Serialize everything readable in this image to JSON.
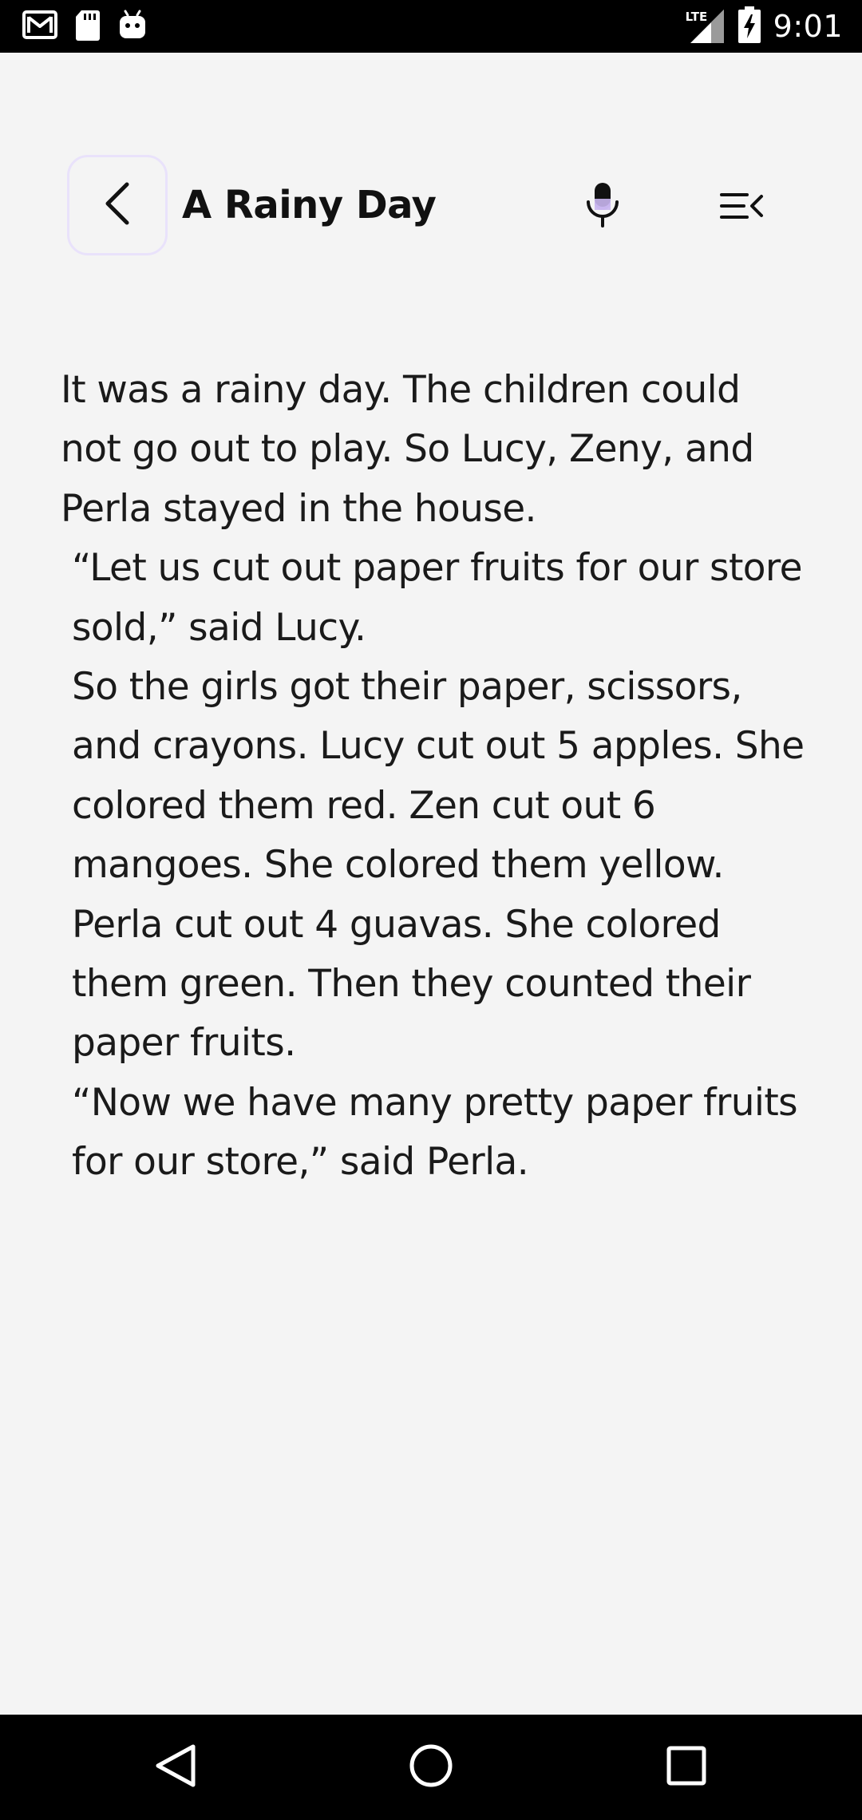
{
  "status_bar": {
    "time": "9:01",
    "network": "LTE",
    "left_icons": [
      "gmail-icon",
      "sd-card-icon",
      "android-icon"
    ],
    "right_icons": [
      "signal-icon",
      "battery-charging-icon"
    ]
  },
  "header": {
    "title": "A Rainy Day",
    "back_icon": "chevron-left-icon",
    "mic_icon": "microphone-icon",
    "menu_icon": "menu-collapse-icon"
  },
  "story": {
    "paragraphs": [
      "It was a rainy day. The children could not go out to play. So Lucy, Zeny, and Perla stayed in the house.",
      "“Let us cut out paper fruits for our store sold,” said Lucy.",
      "So the girls got their paper, scissors, and crayons. Lucy cut out 5 apples. She colored them red. Zen cut out 6 mangoes. She colored them yellow. Perla cut out 4 guavas. She colored them green. Then they counted their paper fruits.",
      "“Now we have many pretty paper fruits for our store,” said Perla."
    ]
  },
  "nav_bar": {
    "back_icon": "nav-back-icon",
    "home_icon": "nav-home-icon",
    "recents_icon": "nav-recents-icon"
  },
  "colors": {
    "background": "#f4f4f4",
    "text": "#1a1a1a",
    "back_button_border": "#e9e2fb",
    "mic_accent": "#c9b6f0",
    "system_bars": "#000000"
  }
}
